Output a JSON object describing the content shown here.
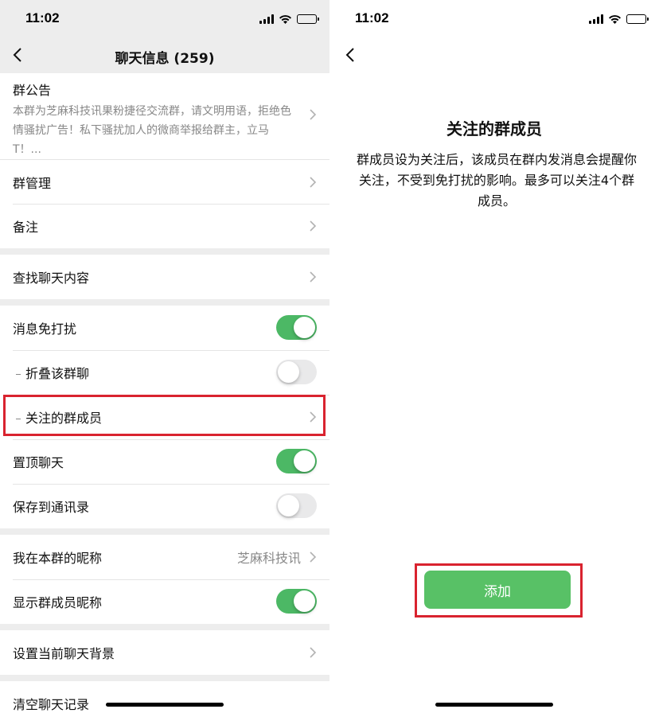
{
  "status_bar": {
    "time": "11:02"
  },
  "left": {
    "nav_title": "聊天信息 (259)",
    "notice": {
      "title": "群公告",
      "text": "本群为芝麻科技讯果粉捷径交流群，请文明用语，拒绝色情骚扰广告！私下骚扰加人的微商举报给群主，立马T！..."
    },
    "items": {
      "group_manage": "群管理",
      "remark": "备注",
      "search_chat": "查找聊天内容",
      "mute": {
        "label": "消息免打扰",
        "on": true
      },
      "fold": {
        "label": "折叠该群聊",
        "on": false
      },
      "followed_members": "关注的群成员",
      "pin": {
        "label": "置顶聊天",
        "on": true
      },
      "save_contacts": {
        "label": "保存到通讯录",
        "on": false
      },
      "my_nickname": {
        "label": "我在本群的昵称",
        "value": "芝麻科技讯"
      },
      "show_nicknames": {
        "label": "显示群成员昵称",
        "on": true
      },
      "set_background": "设置当前聊天背景",
      "clear_history": "清空聊天记录"
    }
  },
  "right": {
    "title": "关注的群成员",
    "description": "群成员设为关注后，该成员在群内发消息会提醒你关注，不受到免打扰的影响。最多可以关注4个群成员。",
    "add_button": "添加"
  },
  "colors": {
    "accent_green": "#4cb865",
    "highlight_red": "#d9232f"
  }
}
